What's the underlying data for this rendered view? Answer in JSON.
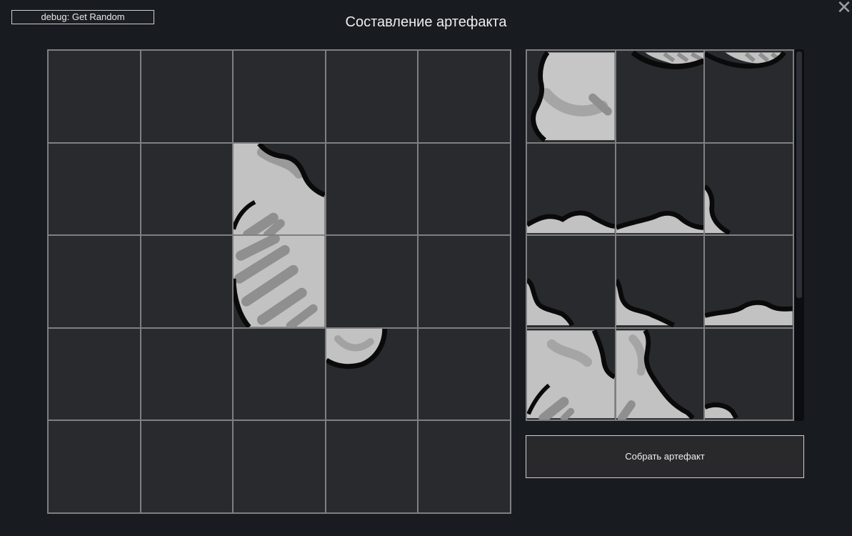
{
  "header": {
    "debug_label": "debug: Get Random",
    "title": "Составление артефакта",
    "close_icon": "close-icon"
  },
  "board": {
    "rows": 5,
    "cols": 5,
    "filled_cells": [
      {
        "row": 2,
        "col": 3,
        "piece": "fish-upper"
      },
      {
        "row": 3,
        "col": 3,
        "piece": "fish-lower"
      },
      {
        "row": 4,
        "col": 4,
        "piece": "fish-tail"
      }
    ]
  },
  "inventory": {
    "rows": 4,
    "cols": 3,
    "pieces": [
      "fish-fragment-1",
      "fish-fragment-2",
      "fish-fragment-3",
      "fish-fragment-4",
      "fish-fragment-5",
      "fish-fragment-6",
      "fish-fragment-7",
      "fish-fragment-8",
      "fish-fragment-9",
      "fish-fragment-10",
      "fish-fragment-11",
      "fish-fragment-12"
    ]
  },
  "actions": {
    "assemble_label": "Собрать артефакт"
  },
  "colors": {
    "background": "#181b20",
    "cell": "#292a2e",
    "grid_line": "#7f7f7f",
    "piece_fill": "#c2c2c2",
    "piece_shade": "#8f8f8f",
    "piece_outline": "#0a0a0a"
  }
}
